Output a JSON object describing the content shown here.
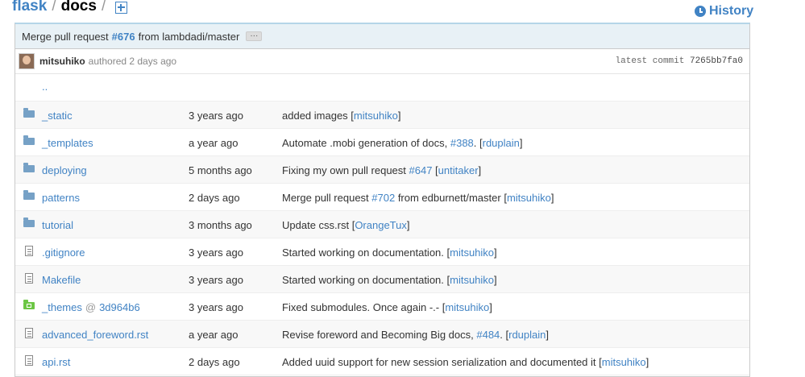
{
  "breadcrumb": {
    "repo": "flask",
    "sep": "/",
    "current": "docs",
    "sep2": "/"
  },
  "history_label": "History",
  "commit": {
    "prefix": "Merge pull request",
    "pr": "#676",
    "suffix": "from lambdadi/master",
    "ellipsis": "···",
    "author": "mitsuhiko",
    "authored": "authored 2 days ago",
    "latest_label": "latest commit",
    "sha": "7265bb7fa0"
  },
  "parent_dir": "..",
  "files": [
    {
      "type": "dir",
      "name": "_static",
      "age": "3 years ago",
      "msg": "added images [",
      "link1": "mitsuhiko",
      "tail": "]"
    },
    {
      "type": "dir",
      "name": "_templates",
      "age": "a year ago",
      "msg": "Automate .mobi generation of docs, ",
      "link0": "#388",
      "mid": ". [",
      "link1": "rduplain",
      "tail": "]"
    },
    {
      "type": "dir",
      "name": "deploying",
      "age": "5 months ago",
      "msg": "Fixing my own pull request ",
      "link0": "#647",
      "mid": " [",
      "link1": "untitaker",
      "tail": "]"
    },
    {
      "type": "dir",
      "name": "patterns",
      "age": "2 days ago",
      "msg": "Merge pull request ",
      "link0": "#702",
      "mid": " from edburnett/master [",
      "link1": "mitsuhiko",
      "tail": "]"
    },
    {
      "type": "dir",
      "name": "tutorial",
      "age": "3 months ago",
      "msg": "Update css.rst [",
      "link1": "OrangeTux",
      "tail": "]"
    },
    {
      "type": "file",
      "name": ".gitignore",
      "age": "3 years ago",
      "msg": "Started working on documentation. [",
      "link1": "mitsuhiko",
      "tail": "]"
    },
    {
      "type": "file",
      "name": "Makefile",
      "age": "3 years ago",
      "msg": "Started working on documentation. [",
      "link1": "mitsuhiko",
      "tail": "]"
    },
    {
      "type": "submodule",
      "name": "_themes",
      "at": "@",
      "ref": "3d964b6",
      "age": "3 years ago",
      "msg": "Fixed submodules. Once again -.- [",
      "link1": "mitsuhiko",
      "tail": "]"
    },
    {
      "type": "file",
      "name": "advanced_foreword.rst",
      "age": "a year ago",
      "msg": "Revise foreword and Becoming Big docs, ",
      "link0": "#484",
      "mid": ". [",
      "link1": "rduplain",
      "tail": "]"
    },
    {
      "type": "file",
      "name": "api.rst",
      "age": "2 days ago",
      "msg": "Added uuid support for new session serialization and documented it [",
      "link1": "mitsuhiko",
      "tail": "]"
    }
  ]
}
